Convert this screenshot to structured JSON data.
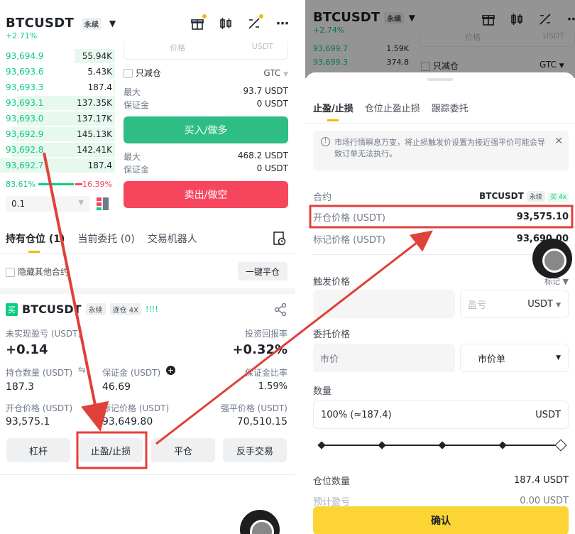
{
  "left": {
    "symbol": "BTCUSDT",
    "contract_tag": "永续",
    "change": "+2.71%",
    "order_book": [
      {
        "price": "93,694.9",
        "qty": "55.94K",
        "depth": 0.35
      },
      {
        "price": "93,693.6",
        "qty": "5.43K",
        "depth": 0.05
      },
      {
        "price": "93,693.3",
        "qty": "187.4",
        "depth": 0.02
      },
      {
        "price": "93,693.1",
        "qty": "137.35K",
        "depth": 0.85
      },
      {
        "price": "93,693.0",
        "qty": "137.17K",
        "depth": 0.85
      },
      {
        "price": "93,692.9",
        "qty": "145.13K",
        "depth": 0.9
      },
      {
        "price": "93,692.8",
        "qty": "142.41K",
        "depth": 0.9
      },
      {
        "price": "93,692.7",
        "qty": "187.4",
        "depth": 1.0
      }
    ],
    "ratio_buy": "83.61%",
    "ratio_sell": "16.39%",
    "depth_select": "0.1",
    "price_placeholder": "价格",
    "reduce_only": "只减仓",
    "gtc": "GTC",
    "max_label": "最大",
    "margin_label": "保证金",
    "buy_max": "93.7 USDT",
    "buy_margin": "0 USDT",
    "buy_button": "买入/做多",
    "sell_max": "468.2 USDT",
    "sell_margin": "0 USDT",
    "sell_button": "卖出/做空",
    "tabs": [
      "持有仓位 (1)",
      "当前委托 (0)",
      "交易机器人"
    ],
    "hide_other": "隐藏其他合约",
    "close_all": "一键平仓",
    "position": {
      "side_badge": "买",
      "symbol": "BTCUSDT",
      "tag": "永续",
      "mode": "逐仓 4X",
      "bars": "!!!!",
      "unrealized_label": "未实现盈亏 (USDT)",
      "unrealized_value": "+0.14",
      "roi_label": "投资回报率",
      "roi_value": "+0.32%",
      "size_label": "持仓数量 (USDT)",
      "size_value": "187.3",
      "margin_label": "保证金 (USDT)",
      "margin_value": "46.69",
      "margin_ratio_label": "保证金比率",
      "margin_ratio_value": "1.59%",
      "entry_label": "开仓价格 (USDT)",
      "entry_value": "93,575.1",
      "mark_label": "标记价格 (USDT)",
      "mark_value": "93,649.80",
      "liq_label": "强平价格 (USDT)",
      "liq_value": "70,510.15"
    },
    "actions": [
      "杠杆",
      "止盈/止损",
      "平仓",
      "反手交易"
    ]
  },
  "right": {
    "symbol": "BTCUSDT",
    "contract_tag": "永续",
    "change": "+2.74%",
    "bg_rows": [
      {
        "price": "93,699.7",
        "qty": "1.59K"
      },
      {
        "price": "93,699.3",
        "qty": "374.8"
      }
    ],
    "bg_reduce_only": "只减仓",
    "bg_gtc": "GTC",
    "bg_field_text": "价格",
    "bg_field_unit": "USDT",
    "tabs": [
      "止盈/止损",
      "仓位止盈止损",
      "跟踪委托"
    ],
    "notice": "市场行情瞬息万变，将止损触发价设置为接近强平价可能会导致订单无法执行。",
    "contract_label": "合约",
    "contract_value": "BTCUSDT",
    "contract_tag2": "永续",
    "contract_side": "买 4x",
    "entry_label": "开仓价格 (USDT)",
    "entry_value": "93,575.10",
    "mark_label": "标记价格 (USDT)",
    "mark_value": "93,690.00",
    "trigger_label": "触发价格",
    "trigger_type": "标记",
    "pnl_placeholder": "盈亏",
    "pnl_unit": "USDT",
    "order_price_label": "委托价格",
    "market_price": "市价",
    "market_order": "市价单",
    "qty_label": "数量",
    "qty_value": "100% (≈187.4)",
    "qty_unit": "USDT",
    "slider_level": 1.0,
    "pos_qty_label": "仓位数量",
    "pos_qty_value": "187.4 USDT",
    "est_pnl_label": "预计盈亏",
    "est_pnl_value": "0.00 USDT",
    "confirm": "确认"
  },
  "colors": {
    "green": "#0ecb81",
    "red": "#f6465d",
    "yellow": "#fcd535",
    "annotation": "#e0413b"
  }
}
